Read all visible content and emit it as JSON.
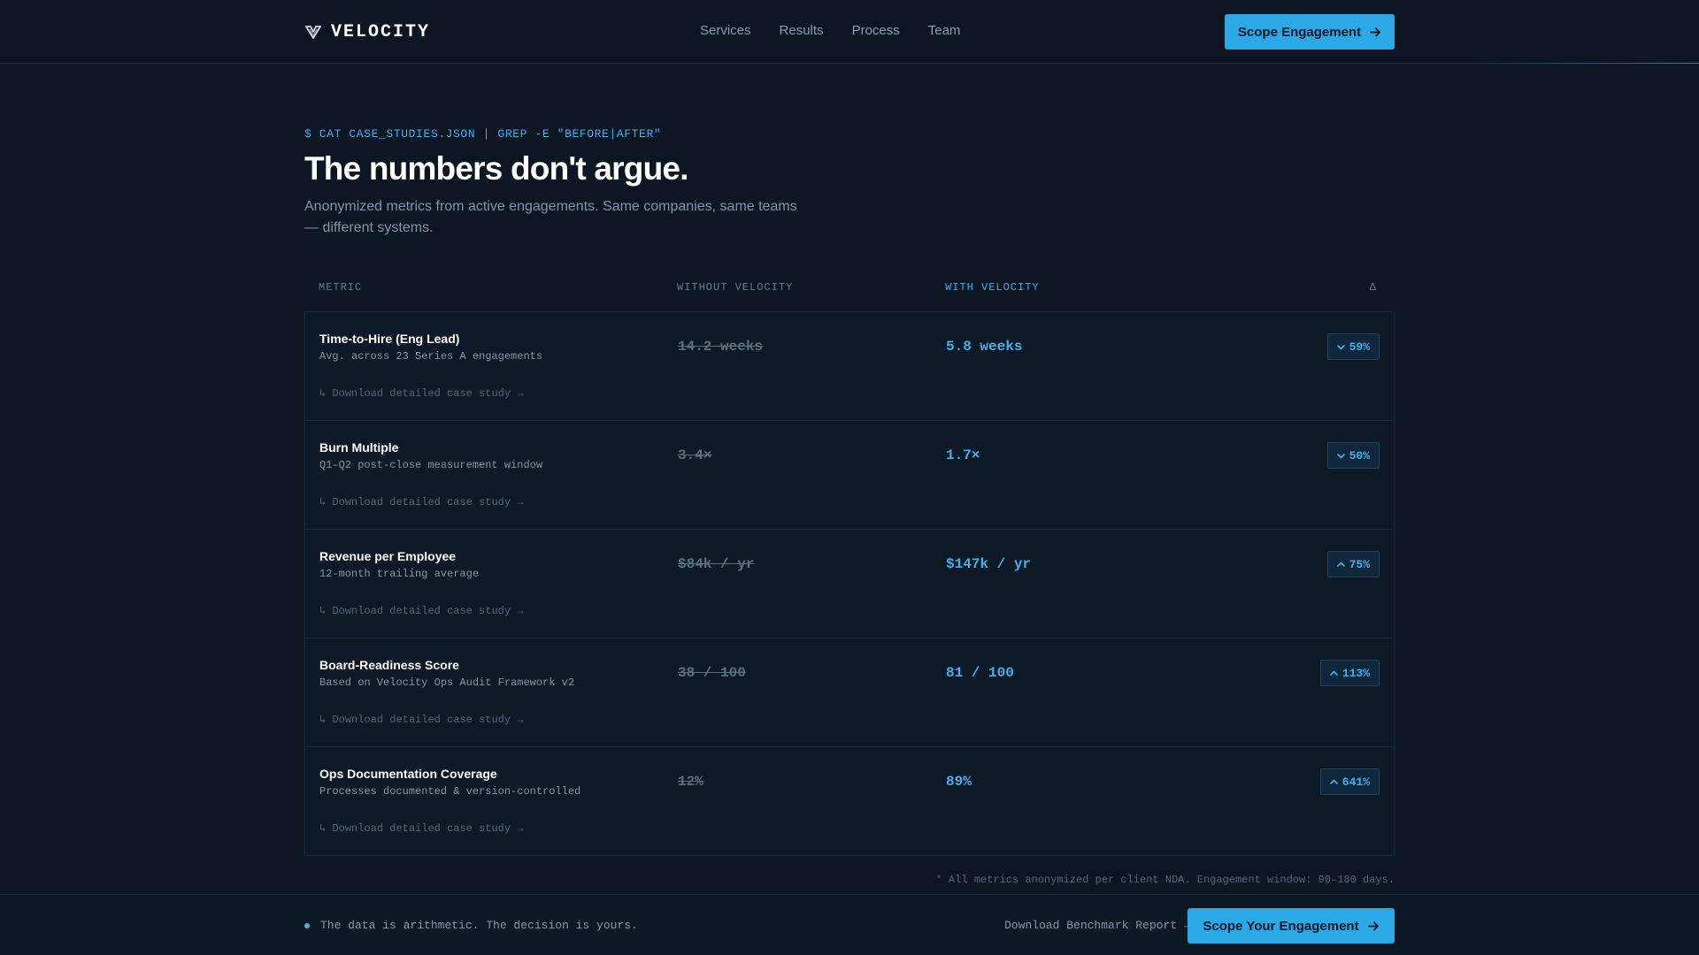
{
  "nav": {
    "brand": "VELOCITY",
    "brand_icon": "velocity-logo-icon",
    "links": [
      "Services",
      "Results",
      "Process",
      "Team"
    ],
    "cta_label": "Scope Engagement"
  },
  "hero": {
    "command": "$ CAT CASE_STUDIES.JSON | GREP -E \"BEFORE|AFTER\"",
    "headline": "The numbers don't argue.",
    "subtitle": "Anonymized metrics from active engagements. Same companies, same teams — different systems."
  },
  "table": {
    "columns": {
      "metric": "METRIC",
      "without": "WITHOUT VELOCITY",
      "with": "WITH VELOCITY",
      "delta": "Δ"
    },
    "rows": [
      {
        "title": "Time-to-Hire (Eng Lead)",
        "subtitle": "Avg. across 23 Series A engagements",
        "without": "14.2 weeks",
        "with": "5.8 weeks",
        "delta": "59%",
        "direction": "down",
        "link": "↳ Download detailed case study →"
      },
      {
        "title": "Burn Multiple",
        "subtitle": "Q1–Q2 post-close measurement window",
        "without": "3.4×",
        "with": "1.7×",
        "delta": "50%",
        "direction": "down",
        "link": "↳ Download detailed case study →"
      },
      {
        "title": "Revenue per Employee",
        "subtitle": "12-month trailing average",
        "without": "$84k / yr",
        "with": "$147k / yr",
        "delta": "75%",
        "direction": "up",
        "link": "↳ Download detailed case study →"
      },
      {
        "title": "Board-Readiness Score",
        "subtitle": "Based on Velocity Ops Audit Framework v2",
        "without": "38 / 100",
        "with": "81 / 100",
        "delta": "113%",
        "direction": "up",
        "link": "↳ Download detailed case study →"
      },
      {
        "title": "Ops Documentation Coverage",
        "subtitle": "Processes documented & version-controlled",
        "without": "12%",
        "with": "89%",
        "delta": "641%",
        "direction": "up",
        "link": "↳ Download detailed case study →"
      }
    ],
    "footnote": "* All metrics anonymized per client NDA. Engagement window: 90–180 days."
  },
  "bottom_bar": {
    "status": "The data is arithmetic. The decision is yours.",
    "bench_link": "Download Benchmark Report →",
    "cta_label": "Scope Your Engagement"
  },
  "colors": {
    "background": "#0b1622",
    "accent": "#2ba8e6",
    "accent_text": "#3fb1ec",
    "muted": "#8393a7"
  }
}
